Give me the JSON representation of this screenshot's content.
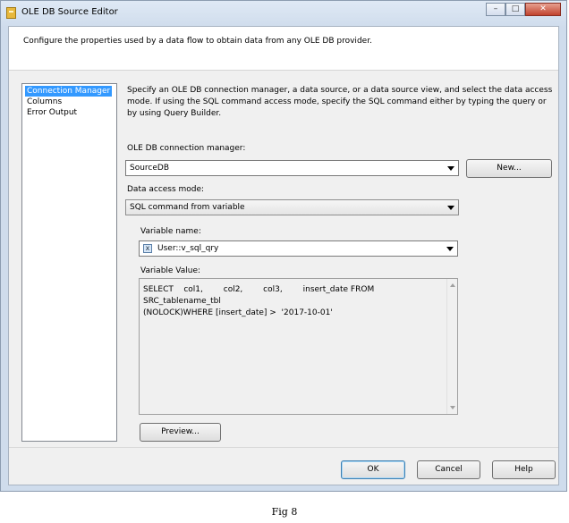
{
  "window": {
    "title": "OLE DB Source Editor",
    "controls": {
      "minimize": "–",
      "maximize": "□",
      "close": "✕"
    }
  },
  "header": {
    "text": "Configure the properties used by a data flow to obtain data from any OLE DB provider."
  },
  "nav": {
    "items": [
      {
        "label": "Connection Manager",
        "selected": true
      },
      {
        "label": "Columns",
        "selected": false
      },
      {
        "label": "Error Output",
        "selected": false
      }
    ]
  },
  "main": {
    "description": "Specify an OLE DB connection manager, a data source, or a data source view, and select the data access mode. If using the SQL command access mode, specify the SQL command either by typing the query or by using Query Builder.",
    "connection_label": "OLE DB connection manager:",
    "connection_value": "SourceDB",
    "new_button": "New...",
    "access_mode_label": "Data access mode:",
    "access_mode_value": "SQL command from variable",
    "variable_name_label": "Variable name:",
    "variable_name_value": "User::v_sql_qry",
    "variable_value_label": "Variable Value:",
    "variable_value": "SELECT    col1,        col2,        col3,        insert_date FROM SRC_tablename_tbl\n(NOLOCK)WHERE [insert_date] >  '2017-10-01'",
    "preview_button": "Preview..."
  },
  "footer": {
    "ok": "OK",
    "cancel": "Cancel",
    "help": "Help"
  },
  "caption": "Fig 8",
  "colors": {
    "selection": "#3399ff",
    "client_bg": "#f0f0f0",
    "titlebar": "#dfe9f5",
    "close_button": "#c0422e"
  }
}
